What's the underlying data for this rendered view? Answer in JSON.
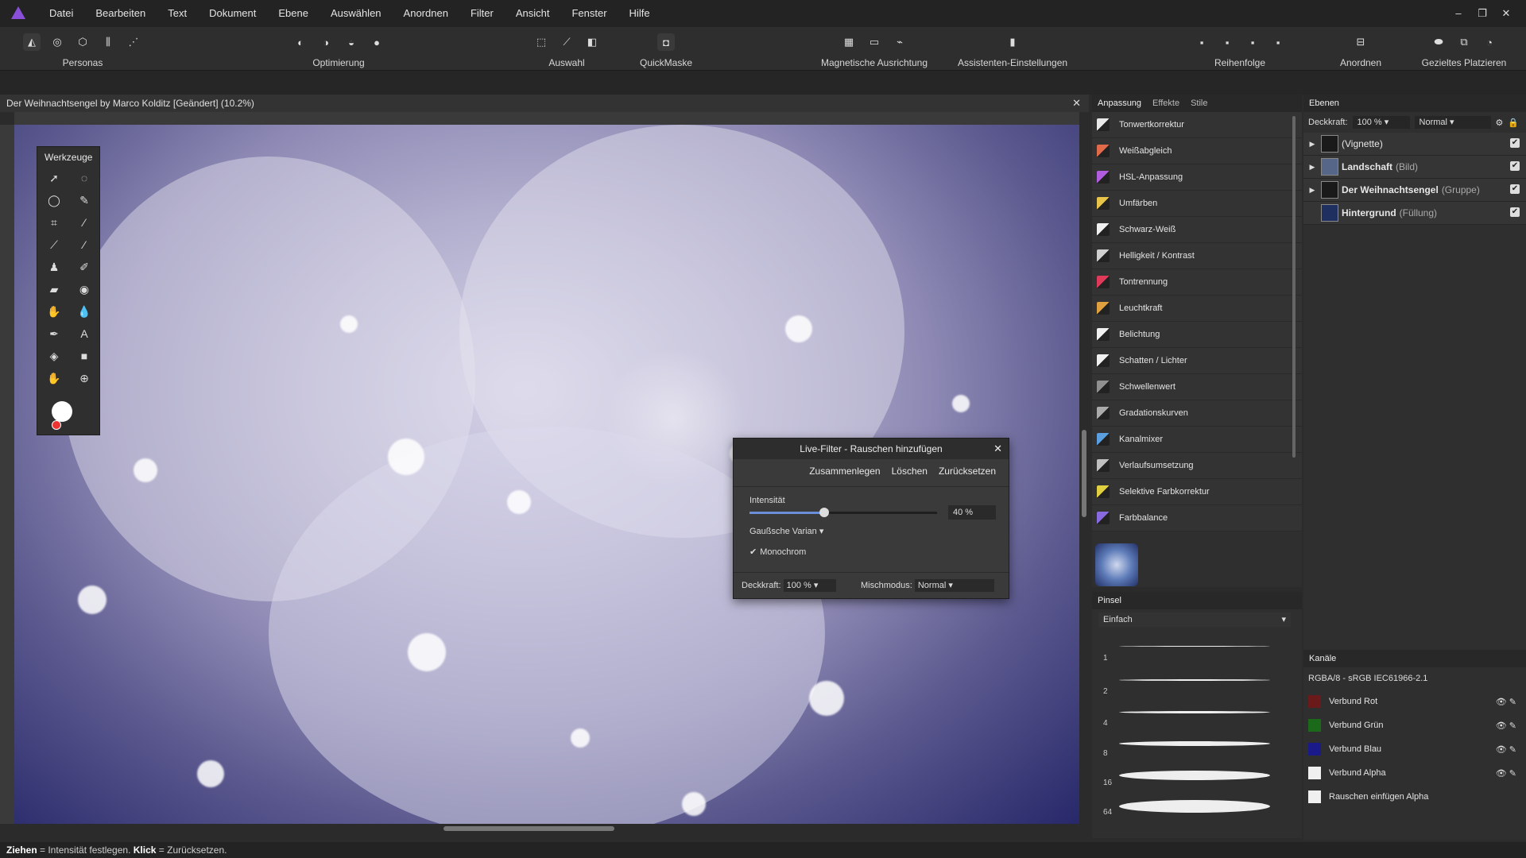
{
  "menu": [
    "Datei",
    "Bearbeiten",
    "Text",
    "Dokument",
    "Ebene",
    "Auswählen",
    "Anordnen",
    "Filter",
    "Ansicht",
    "Fenster",
    "Hilfe"
  ],
  "toolbar": {
    "personas": "Personas",
    "optimierung": "Optimierung",
    "auswahl": "Auswahl",
    "quickmaske": "QuickMaske",
    "magnetisch": "Magnetische Ausrichtung",
    "assistent": "Assistenten-Einstellungen",
    "reihenfolge": "Reihenfolge",
    "anordnen": "Anordnen",
    "platzieren": "Gezieltes Platzieren"
  },
  "document": {
    "title": "Der Weihnachtsengel by Marco Kolditz [Geändert] (10.2%)"
  },
  "tools_panel": {
    "title": "Werkzeuge"
  },
  "dialog": {
    "title": "Live-Filter - Rauschen hinzufügen",
    "btn_merge": "Zusammenlegen",
    "btn_delete": "Löschen",
    "btn_reset": "Zurücksetzen",
    "intensity_label": "Intensität",
    "intensity_value": "40 %",
    "intensity_fraction": 0.4,
    "distribution": "Gaußsche Varian",
    "monochrome": "Monochrom",
    "opacity_label": "Deckkraft:",
    "opacity_value": "100 %",
    "blend_label": "Mischmodus:",
    "blend_value": "Normal"
  },
  "adjust_tabs": [
    "Anpassung",
    "Effekte",
    "Stile"
  ],
  "adjustments": [
    {
      "label": "Tonwertkorrektur",
      "color": "#e8e8e8"
    },
    {
      "label": "Weißabgleich",
      "color": "#e06a4a"
    },
    {
      "label": "HSL-Anpassung",
      "color": "#b25de0"
    },
    {
      "label": "Umfärben",
      "color": "#e8c34a"
    },
    {
      "label": "Schwarz-Weiß",
      "color": "#f0f0f0"
    },
    {
      "label": "Helligkeit / Kontrast",
      "color": "#d0d0d0"
    },
    {
      "label": "Tontrennung",
      "color": "#e03a5a"
    },
    {
      "label": "Leuchtkraft",
      "color": "#e0a040"
    },
    {
      "label": "Belichtung",
      "color": "#f0f0f0"
    },
    {
      "label": "Schatten / Lichter",
      "color": "#f0f0f0"
    },
    {
      "label": "Schwellenwert",
      "color": "#909090"
    },
    {
      "label": "Gradationskurven",
      "color": "#aaaaaa"
    },
    {
      "label": "Kanalmixer",
      "color": "#5aa0e0"
    },
    {
      "label": "Verlaufsumsetzung",
      "color": "#c0c0c0"
    },
    {
      "label": "Selektive Farbkorrektur",
      "color": "#e0d040"
    },
    {
      "label": "Farbbalance",
      "color": "#8a6ae0"
    }
  ],
  "brushes": {
    "title": "Pinsel",
    "category": "Einfach",
    "sizes": [
      "1",
      "2",
      "4",
      "8",
      "16",
      "64"
    ]
  },
  "layers": {
    "title": "Ebenen",
    "opacity_label": "Deckkraft:",
    "opacity_value": "100 %",
    "blend_value": "Normal",
    "items": [
      {
        "name": "(Vignette)",
        "type": "",
        "bold": false
      },
      {
        "name": "Landschaft",
        "type": "(Bild)",
        "bold": true
      },
      {
        "name": "Der Weihnachtsengel",
        "type": "(Gruppe)",
        "bold": true
      },
      {
        "name": "Hintergrund",
        "type": "(Füllung)",
        "bold": true
      }
    ]
  },
  "channels": {
    "title": "Kanäle",
    "profile": "RGBA/8 - sRGB IEC61966-2.1",
    "items": [
      {
        "label": "Verbund Rot",
        "color": "#6a1a1a"
      },
      {
        "label": "Verbund Grün",
        "color": "#1a6a1a"
      },
      {
        "label": "Verbund Blau",
        "color": "#1a1a8a"
      },
      {
        "label": "Verbund Alpha",
        "color": "#f0f0f0"
      },
      {
        "label": "Rauschen einfügen Alpha",
        "color": "#f0f0f0"
      }
    ]
  },
  "status": {
    "drag": "Ziehen",
    "drag_text": " = Intensität festlegen. ",
    "click": "Klick",
    "click_text": " = Zurücksetzen."
  }
}
